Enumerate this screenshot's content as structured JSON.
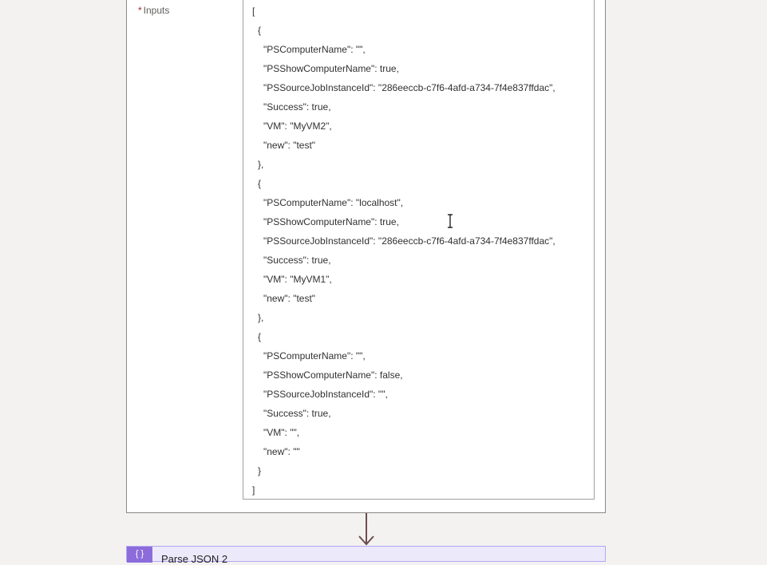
{
  "inputs_field": {
    "required_marker": "*",
    "label": "Inputs",
    "lines": [
      {
        "indent": 0,
        "text": "["
      },
      {
        "indent": 1,
        "text": "{"
      },
      {
        "indent": 2,
        "text": "\"PSComputerName\": \"\","
      },
      {
        "indent": 2,
        "text": "\"PSShowComputerName\": true,"
      },
      {
        "indent": 2,
        "text": "\"PSSourceJobInstanceId\": \"286eeccb-c7f6-4afd-a734-7f4e837ffdac\","
      },
      {
        "indent": 2,
        "text": "\"Success\": true,"
      },
      {
        "indent": 2,
        "text": "\"VM\": \"MyVM2\","
      },
      {
        "indent": 2,
        "text": "\"new\": \"test\""
      },
      {
        "indent": 1,
        "text": "},"
      },
      {
        "indent": 1,
        "text": "{"
      },
      {
        "indent": 2,
        "text": "\"PSComputerName\": \"localhost\","
      },
      {
        "indent": 2,
        "text": "\"PSShowComputerName\": true,"
      },
      {
        "indent": 2,
        "text": "\"PSSourceJobInstanceId\": \"286eeccb-c7f6-4afd-a734-7f4e837ffdac\","
      },
      {
        "indent": 2,
        "text": "\"Success\": true,"
      },
      {
        "indent": 2,
        "text": "\"VM\": \"MyVM1\","
      },
      {
        "indent": 2,
        "text": "\"new\": \"test\""
      },
      {
        "indent": 1,
        "text": "},"
      },
      {
        "indent": 1,
        "text": "{"
      },
      {
        "indent": 2,
        "text": "\"PSComputerName\": \"\","
      },
      {
        "indent": 2,
        "text": "\"PSShowComputerName\": false,"
      },
      {
        "indent": 2,
        "text": "\"PSSourceJobInstanceId\": \"\","
      },
      {
        "indent": 2,
        "text": "\"Success\": true,"
      },
      {
        "indent": 2,
        "text": "\"VM\": \"\","
      },
      {
        "indent": 2,
        "text": "\"new\": \"\""
      },
      {
        "indent": 1,
        "text": "}"
      },
      {
        "indent": 0,
        "text": "]"
      }
    ]
  },
  "next_action": {
    "icon": "{ }",
    "icon_name": "curly-braces-icon",
    "title": "Parse JSON 2"
  },
  "colors": {
    "required": "#a4262c",
    "connector_arrow": "#6e4d4d",
    "action_accent": "#8c6cdb"
  }
}
